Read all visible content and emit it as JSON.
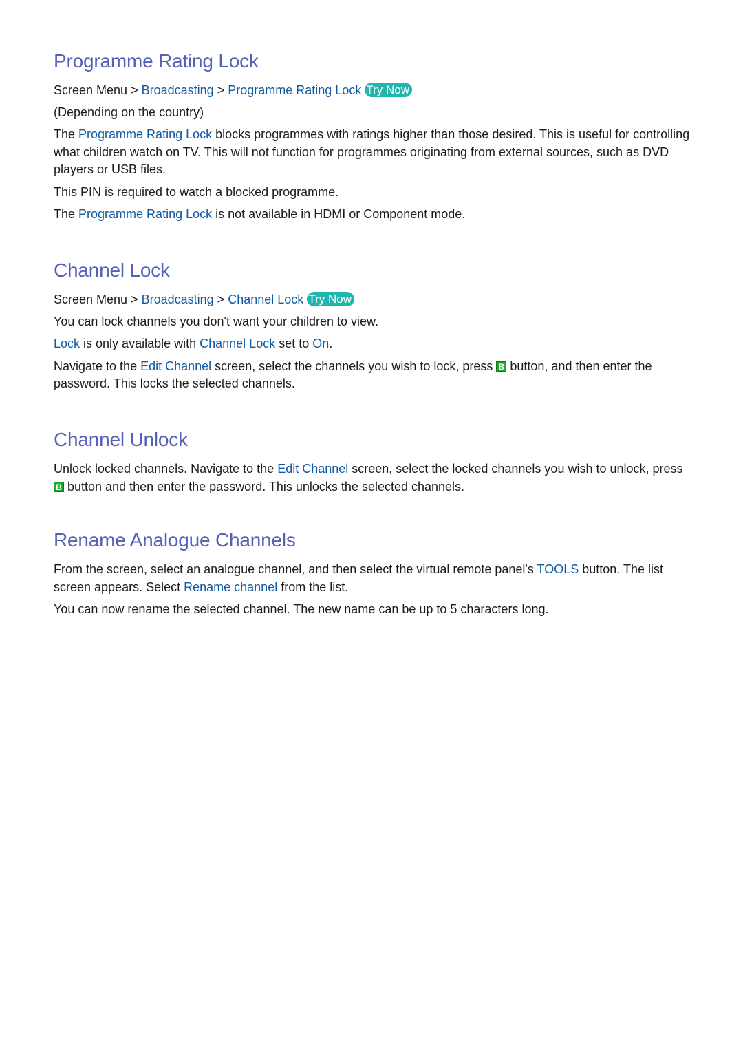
{
  "sections": {
    "programme_rating_lock": {
      "title": "Programme Rating Lock",
      "path": {
        "root": "Screen Menu",
        "separator": ">",
        "item1": "Broadcasting",
        "item2": "Programme Rating Lock",
        "try_now": "Try Now"
      },
      "note": "(Depending on the country)",
      "para1": {
        "pre": "The ",
        "link": "Programme Rating Lock",
        "post": " blocks programmes with ratings higher than those desired. This is useful for controlling what children watch on TV. This will not function for programmes originating from external sources, such as DVD players or USB files."
      },
      "para2": "This PIN is required to watch a blocked programme.",
      "para3": {
        "pre": "The ",
        "link": "Programme Rating Lock",
        "post": " is not available in HDMI or Component mode."
      }
    },
    "channel_lock": {
      "title": "Channel Lock",
      "path": {
        "root": "Screen Menu",
        "separator": ">",
        "item1": "Broadcasting",
        "item2": "Channel Lock",
        "try_now": "Try Now"
      },
      "para1": "You can lock channels you don't want your children to view.",
      "para2": {
        "link1": "Lock",
        "mid1": " is only available with ",
        "link2": "Channel Lock",
        "mid2": " set to ",
        "link3": "On",
        "end": "."
      },
      "para3": {
        "pre": "Navigate to the ",
        "link": "Edit Channel",
        "mid": " screen, select the channels you wish to lock, press ",
        "key": "B",
        "post": " button, and then enter the password. This locks the selected channels."
      }
    },
    "channel_unlock": {
      "title": "Channel Unlock",
      "para1": {
        "pre": "Unlock locked channels. Navigate to the ",
        "link": "Edit Channel",
        "mid": " screen, select the locked channels you wish to unlock, press ",
        "key": "B",
        "post": " button and then enter the password. This unlocks the selected channels."
      }
    },
    "rename_analogue_channels": {
      "title": "Rename Analogue Channels",
      "para1": {
        "pre": "From the screen, select an analogue channel, and then select the virtual remote panel's ",
        "link1": "TOOLS",
        "mid": " button. The list screen appears. Select ",
        "link2": "Rename channel",
        "post": " from the list."
      },
      "para2": "You can now rename the selected channel. The new name can be up to 5 characters long."
    }
  },
  "colors": {
    "heading": "#5660b8",
    "link": "#0f5aa4",
    "try_now_bg": "#22b5ad",
    "b_key_bg": "#1eaa2c"
  }
}
